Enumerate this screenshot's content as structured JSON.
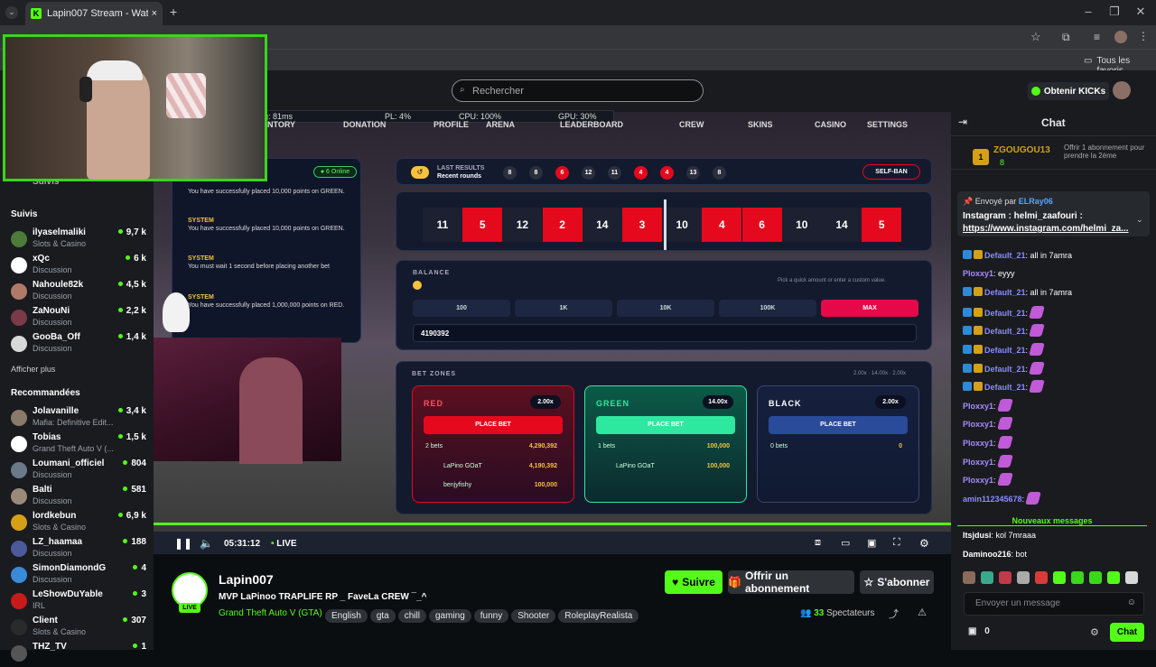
{
  "browser": {
    "tab_title": "Lapin007 Stream - Watch Li",
    "bookmarks_label": "Tous les favoris"
  },
  "header": {
    "search_placeholder": "Rechercher",
    "get_kicks": "Obtenir KICKs"
  },
  "sidebar": {
    "followed_label": "Suivis",
    "followed_label_top": "Suivis",
    "followed": [
      {
        "name": "ilyaselmaliki",
        "category": "Slots & Casino",
        "viewers": "9,7 k",
        "color": "#4e7a3a"
      },
      {
        "name": "xQc",
        "category": "Discussion",
        "viewers": "6 k",
        "color": "#ffffff"
      },
      {
        "name": "Nahoule82k",
        "category": "Discussion",
        "viewers": "4,5 k",
        "color": "#b07a68"
      },
      {
        "name": "ZaNouNi",
        "category": "Discussion",
        "viewers": "2,2 k",
        "color": "#7a3a48"
      },
      {
        "name": "GooBa_Off",
        "category": "Discussion",
        "viewers": "1,4 k",
        "color": "#d8d8d8"
      }
    ],
    "show_more": "Afficher plus",
    "recommended_label": "Recommandées",
    "recommended": [
      {
        "name": "Jolavanille",
        "category": "Mafia: Definitive Edit...",
        "viewers": "3,4 k",
        "color": "#8a7a6a"
      },
      {
        "name": "Tobias",
        "category": "Grand Theft Auto V (...",
        "viewers": "1,5 k",
        "color": "#ffffff"
      },
      {
        "name": "Loumani_officiel",
        "category": "Discussion",
        "viewers": "804",
        "color": "#6a7a8a"
      },
      {
        "name": "Balti",
        "category": "Discussion",
        "viewers": "581",
        "color": "#9a8a7a"
      },
      {
        "name": "lordkebun",
        "category": "Slots & Casino",
        "viewers": "6,9 k",
        "color": "#d4a017"
      },
      {
        "name": "LZ_haamaa",
        "category": "Discussion",
        "viewers": "188",
        "color": "#4a5a9a"
      },
      {
        "name": "SimonDiamondG",
        "category": "Discussion",
        "viewers": "4",
        "color": "#3a8ad8"
      },
      {
        "name": "LeShowDuYable",
        "category": "IRL",
        "viewers": "3",
        "color": "#c81a1a"
      },
      {
        "name": "Client",
        "category": "Slots & Casino",
        "viewers": "307",
        "color": "#2a2a2a"
      },
      {
        "name": "THZ_TV",
        "category": "",
        "viewers": "1",
        "color": "#555555"
      }
    ]
  },
  "game": {
    "hud": {
      "ping": "ng: 81ms",
      "pl": "PL: 4%",
      "cpu": "CPU: 100%",
      "gpu": "GPU: 30%"
    },
    "menu": [
      "ENTORY",
      "DONATION",
      "PROFILE",
      "ARENA",
      "LEADERBOARD",
      "CREW",
      "SKINS",
      "CASINO",
      "SETTINGS"
    ],
    "online": "6 Online",
    "last_results_title": "LAST RESULTS",
    "last_results_sub": "Recent rounds",
    "last_results": [
      {
        "n": "8",
        "c": "black"
      },
      {
        "n": "8",
        "c": "black"
      },
      {
        "n": "6",
        "c": "red"
      },
      {
        "n": "12",
        "c": "black"
      },
      {
        "n": "11",
        "c": "black"
      },
      {
        "n": "4",
        "c": "red"
      },
      {
        "n": "4",
        "c": "red"
      },
      {
        "n": "13",
        "c": "black"
      },
      {
        "n": "8",
        "c": "black"
      }
    ],
    "self_ban": "SELF-BAN",
    "roll": [
      {
        "n": "11",
        "c": "black"
      },
      {
        "n": "5",
        "c": "red"
      },
      {
        "n": "12",
        "c": "black"
      },
      {
        "n": "2",
        "c": "red"
      },
      {
        "n": "14",
        "c": "black"
      },
      {
        "n": "3",
        "c": "red"
      },
      {
        "n": "10",
        "c": "black"
      },
      {
        "n": "4",
        "c": "red"
      },
      {
        "n": "6",
        "c": "red"
      },
      {
        "n": "10",
        "c": "black"
      },
      {
        "n": "14",
        "c": "black"
      },
      {
        "n": "5",
        "c": "red"
      }
    ],
    "balance_label": "BALANCE",
    "balance_hint": "Pick a quick amount or enter a custom value.",
    "amounts": [
      "100",
      "1K",
      "10K",
      "100K",
      "MAX"
    ],
    "amount_value": "4190392",
    "bet_zones_label": "BET ZONES",
    "bet_zones_mult": "2.00x · 14.00x · 2.00x",
    "zones": [
      {
        "name": "RED",
        "mult": "2.00x",
        "button": "PLACE BET",
        "bets": "2 bets",
        "total": "4,290,392",
        "entries": [
          {
            "user": "LaPino GOaT",
            "amount": "4,190,392"
          },
          {
            "user": "benjyfishy",
            "amount": "100,000"
          }
        ]
      },
      {
        "name": "GREEN",
        "mult": "14.00x",
        "button": "PLACE BET",
        "bets": "1 bets",
        "total": "100,000",
        "entries": [
          {
            "user": "LaPino GOaT",
            "amount": "100,000"
          }
        ]
      },
      {
        "name": "BLACK",
        "mult": "2.00x",
        "button": "PLACE BET",
        "bets": "0 bets",
        "total": "0",
        "entries": []
      }
    ],
    "system_messages": [
      {
        "title": "",
        "text": "You have successfully placed 10,000 points on GREEN."
      },
      {
        "title": "SYSTEM",
        "text": "You have successfully placed 10,000 points on GREEN."
      },
      {
        "title": "SYSTEM",
        "text": "You must wait 1 second before placing another bet"
      },
      {
        "title": "SYSTEM",
        "text": "You have successfully placed 1,000,000 points on RED."
      }
    ]
  },
  "player": {
    "time": "05:31:12",
    "live": "LIVE",
    "progress": 1.0
  },
  "stream": {
    "channel": "Lapin007",
    "title": "MVP LaPinoo TRAPLIFE RP _  FaveLa CREW ¯_^",
    "category": "Grand Theft Auto V (GTA)",
    "tags": [
      "English",
      "gta",
      "chill",
      "gaming",
      "funny",
      "Shooter",
      "RoleplayRealista"
    ],
    "viewers": "33",
    "viewers_label": "Spectateurs",
    "live_badge": "LIVE",
    "follow": "Suivre",
    "gift_sub": "Offrir un abonnement",
    "subscribe": "S'abonner"
  },
  "chat": {
    "title": "Chat",
    "gifter": {
      "name": "ZGOUGOU13",
      "count": "8",
      "text": "Offrir 1 abonnement pour prendre la 2ème"
    },
    "pinned_by_label": "Envoyé par",
    "pinned_by": "ELRay06",
    "pinned_text": "Instagram : helmi_zaafouri :",
    "pinned_link": "https://www.instagram.com/helmi_za...",
    "messages": [
      {
        "user": "Default_21",
        "text": ": all in 7amra",
        "color": "#8a8aff",
        "emote": false,
        "badges": true
      },
      {
        "user": "Ploxxy1",
        "text": ": eyyy",
        "color": "#a88aff",
        "emote": false,
        "badges": false
      },
      {
        "user": "Default_21",
        "text": ": all in 7amra",
        "color": "#8a8aff",
        "emote": false,
        "badges": true
      },
      {
        "user": "Default_21",
        "text": ":",
        "color": "#8a8aff",
        "emote": true,
        "badges": true
      },
      {
        "user": "Default_21",
        "text": ":",
        "color": "#8a8aff",
        "emote": true,
        "badges": true
      },
      {
        "user": "Default_21",
        "text": ":",
        "color": "#8a8aff",
        "emote": true,
        "badges": true
      },
      {
        "user": "Default_21",
        "text": ":",
        "color": "#8a8aff",
        "emote": true,
        "badges": true
      },
      {
        "user": "Default_21",
        "text": ":",
        "color": "#8a8aff",
        "emote": true,
        "badges": true
      },
      {
        "user": "Ploxxy1",
        "text": ":",
        "color": "#a88aff",
        "emote": true,
        "badges": false
      },
      {
        "user": "Ploxxy1",
        "text": ":",
        "color": "#a88aff",
        "emote": true,
        "badges": false
      },
      {
        "user": "Ploxxy1",
        "text": ":",
        "color": "#a88aff",
        "emote": true,
        "badges": false
      },
      {
        "user": "Ploxxy1",
        "text": ":",
        "color": "#a88aff",
        "emote": true,
        "badges": false
      },
      {
        "user": "Ploxxy1",
        "text": ":",
        "color": "#a88aff",
        "emote": true,
        "badges": false
      },
      {
        "user": "amin112345678",
        "text": ":",
        "color": "#8a8aff",
        "emote": true,
        "badges": false
      }
    ],
    "new_messages": "Nouveaux messages",
    "new": [
      {
        "user": "Itsjdusi",
        "text": ": kol 7mraaa",
        "color": "#ffffff"
      },
      {
        "user": "Daminoo216",
        "text": ": bot",
        "color": "#ffffff"
      }
    ],
    "input_placeholder": "Envoyer un message",
    "points": "0",
    "send": "Chat"
  },
  "colors": {
    "accent": "#53fc18",
    "red": "#e5091d",
    "panel": "#131a2e"
  }
}
